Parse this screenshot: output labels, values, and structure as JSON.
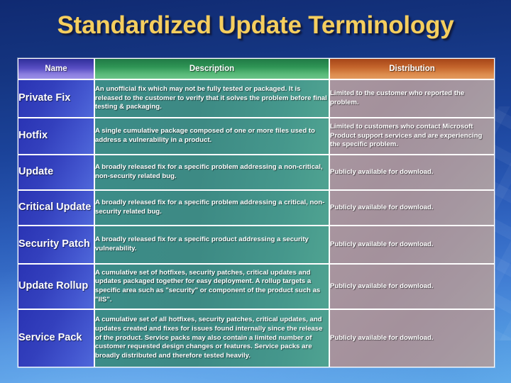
{
  "slide": {
    "title": "Standardized Update Terminology",
    "title_color": "#f5ce5e",
    "background_top_color": "#14347f",
    "background_bottom_color": "#63aeec"
  },
  "table": {
    "headers": {
      "name": "Name",
      "description": "Description",
      "distribution": "Distribution"
    },
    "header_colors": {
      "name": "#5a4fc4",
      "description": "#2f9455",
      "distribution": "#c4652c"
    },
    "cell_colors": {
      "name": "#3340bd",
      "description": "#3d8a84",
      "distribution": "#a4919c"
    },
    "rows": [
      {
        "name": "Private Fix",
        "description": "An unofficial fix which may not be fully tested or packaged. It is released to the customer to verify that it solves the problem before final testing & packaging.",
        "distribution": "Limited to the customer who reported the problem."
      },
      {
        "name": "Hotfix",
        "description": "A single cumulative package composed of one or more files used to address a vulnerability in a product.",
        "distribution": "Limited to customers who contact Microsoft Product support services and are experiencing the specific problem."
      },
      {
        "name": "Update",
        "description": "A broadly released fix for a specific problem addressing a non-critical, non-security related bug.",
        "distribution": "Publicly available for download."
      },
      {
        "name": "Critical Update",
        "description": "A broadly released fix for a specific problem addressing a critical, non-security related bug.",
        "distribution": "Publicly available for download."
      },
      {
        "name": "Security Patch",
        "description": "A broadly released fix for a specific product addressing a security vulnerability.",
        "distribution": "Publicly available for download."
      },
      {
        "name": "Update Rollup",
        "description": "A cumulative set of hotfixes, security patches, critical updates and updates packaged together for easy deployment.  A rollup targets a specific area such as \"security\" or component of the product such as \"IIS\".",
        "distribution": "Publicly available for download."
      },
      {
        "name": "Service Pack",
        "description": "A cumulative set of all hotfixes, security patches, critical updates, and updates created and fixes for issues found internally since the release of the product. Service packs may also contain a limited number of customer requested design changes or features. Service packs are broadly distributed and therefore tested heavily.",
        "distribution": "Publicly available for download."
      }
    ]
  }
}
